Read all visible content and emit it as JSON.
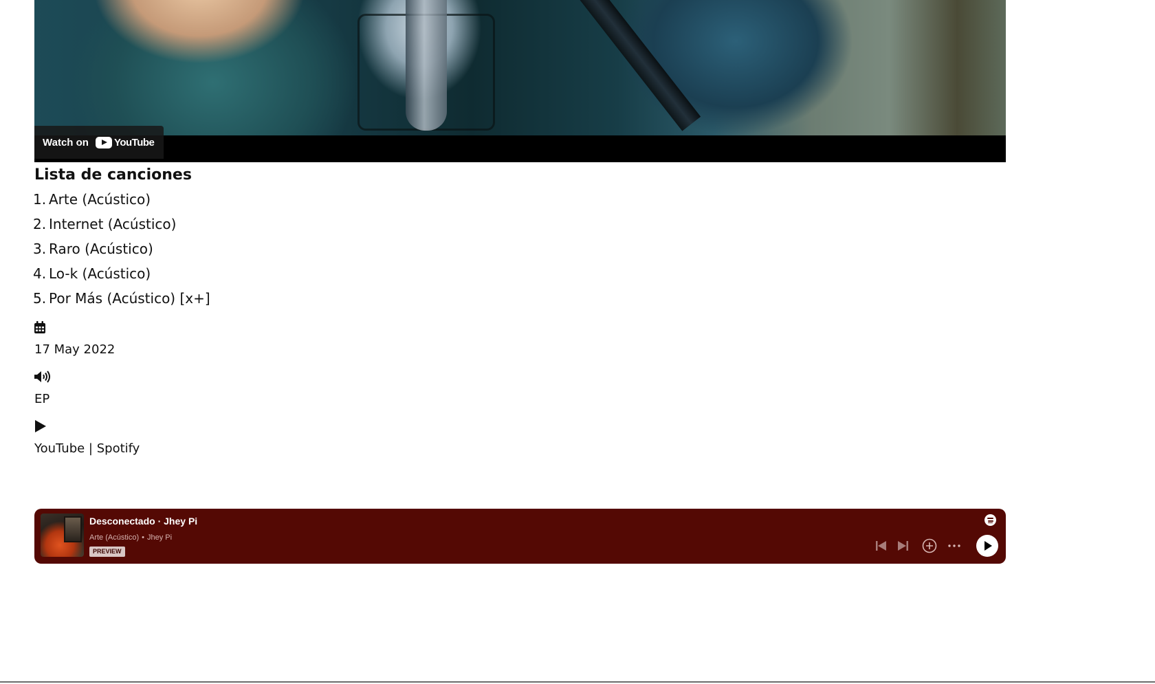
{
  "video": {
    "watch_on_label": "Watch on",
    "platform_label": "YouTube"
  },
  "tracklist": {
    "title": "Lista de canciones",
    "items": [
      {
        "number": "1.",
        "title": "Arte (Acústico)"
      },
      {
        "number": "2.",
        "title": "Internet (Acústico)"
      },
      {
        "number": "3.",
        "title": "Raro (Acústico)"
      },
      {
        "number": "4.",
        "title": "Lo-k (Acústico)"
      },
      {
        "number": "5.",
        "title": "Por Más (Acústico) [x+]"
      }
    ]
  },
  "meta": {
    "release_date": "17 May 2022",
    "release_date_icon": "calendar-icon",
    "type": "EP",
    "type_icon": "volume-icon",
    "links_icon": "play-icon",
    "links": {
      "youtube": "YouTube",
      "separator": " | ",
      "spotify": "Spotify"
    }
  },
  "spotify_player": {
    "title": "Desconectado · Jhey Pi",
    "track": "Arte (Acústico)",
    "separator": "•",
    "artist": "Jhey Pi",
    "badge": "PREVIEW",
    "background_color": "#540904",
    "icons": [
      "spotify-icon",
      "previous-icon",
      "next-icon",
      "add-icon",
      "more-icon",
      "play-icon"
    ]
  }
}
